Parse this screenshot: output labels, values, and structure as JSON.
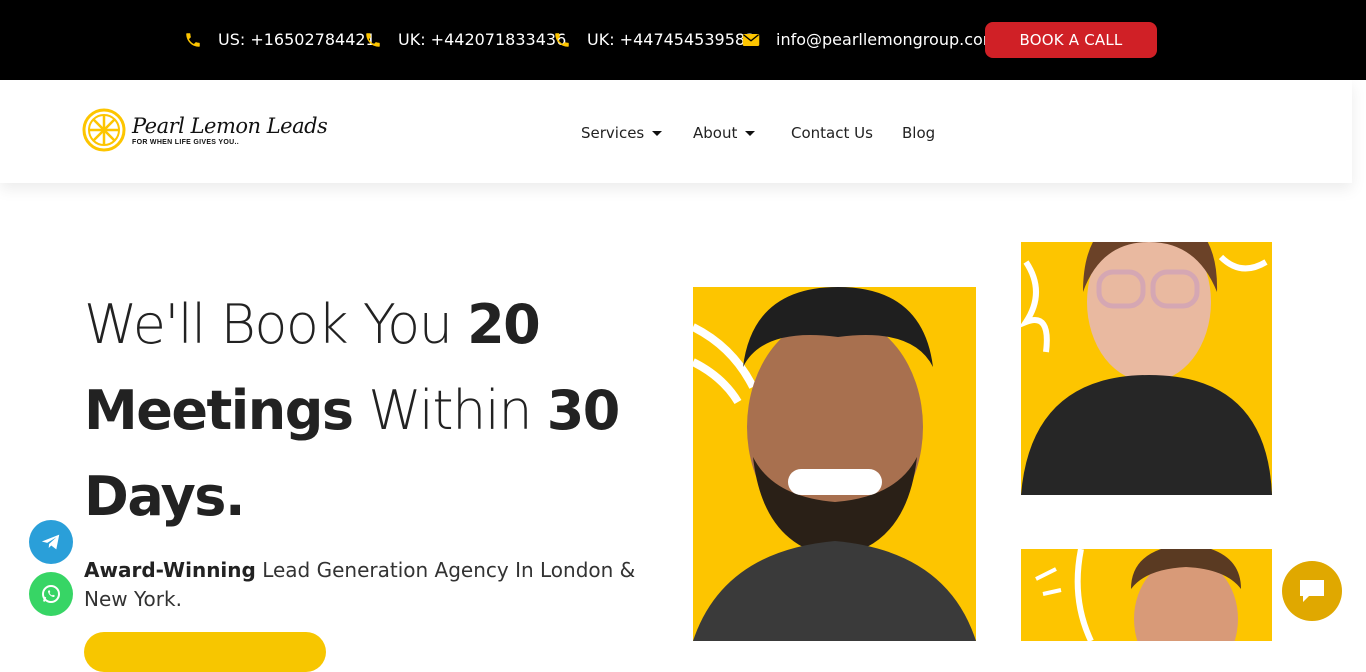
{
  "topbar": {
    "contacts": [
      {
        "icon": "phone-icon",
        "text": "US: +16502784421"
      },
      {
        "icon": "phone-icon",
        "text": "UK: +442071833436"
      },
      {
        "icon": "phone-icon",
        "text": "UK: +447454539583"
      },
      {
        "icon": "envelope-icon",
        "text": "info@pearllemongroup.com"
      }
    ],
    "book_label": "BOOK A CALL"
  },
  "logo": {
    "name": "Pearl Lemon Leads",
    "tagline": "FOR WHEN LIFE GIVES YOU.."
  },
  "nav": {
    "services": "Services",
    "about": "About",
    "contact": "Contact Us",
    "blog": "Blog"
  },
  "hero": {
    "title": {
      "t1": "We'll  Book You",
      "t2": "20",
      "t3": "Meetings",
      "t4": "Within",
      "t5": "30",
      "t6": "Days."
    },
    "sub_bold": "Award-Winning",
    "sub_rest": "Lead Generation Agency In London & New York."
  },
  "colors": {
    "accent": "#fdc500",
    "book_button": "#d02026",
    "topbar": "#000000"
  }
}
